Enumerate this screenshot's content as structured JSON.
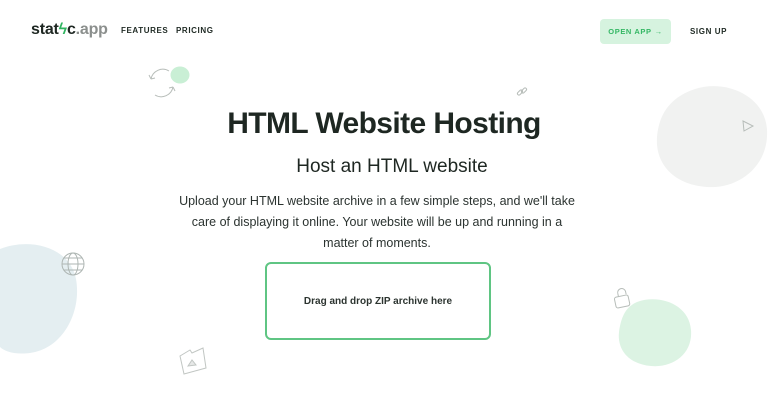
{
  "nav": {
    "logo_main": "stat",
    "logo_bolt": "ϟ",
    "logo_c": "c",
    "logo_ext": ".app",
    "links": [
      "FEATURES",
      "PRICING"
    ],
    "open_app": "OPEN APP",
    "open_app_arrow": "→",
    "sign_up": "SIGN UP"
  },
  "hero": {
    "title": "HTML Website Hosting",
    "subtitle": "Host an HTML website",
    "description": "Upload your HTML website archive in a few simple steps, and we'll take care of displaying it online. Your website will be up and running in a matter of moments."
  },
  "dropzone": {
    "label": "Drag and drop ZIP archive here"
  },
  "colors": {
    "accent": "#34b764",
    "accent_light": "#d6f3df",
    "blob_grey": "#f1f2f1",
    "blob_blue": "#e4eef1",
    "blob_green": "#dcf3e3"
  },
  "decor_icons": [
    "refresh-icon",
    "link-icon",
    "triangle-icon",
    "globe-icon",
    "lock-icon",
    "folder-icon"
  ]
}
